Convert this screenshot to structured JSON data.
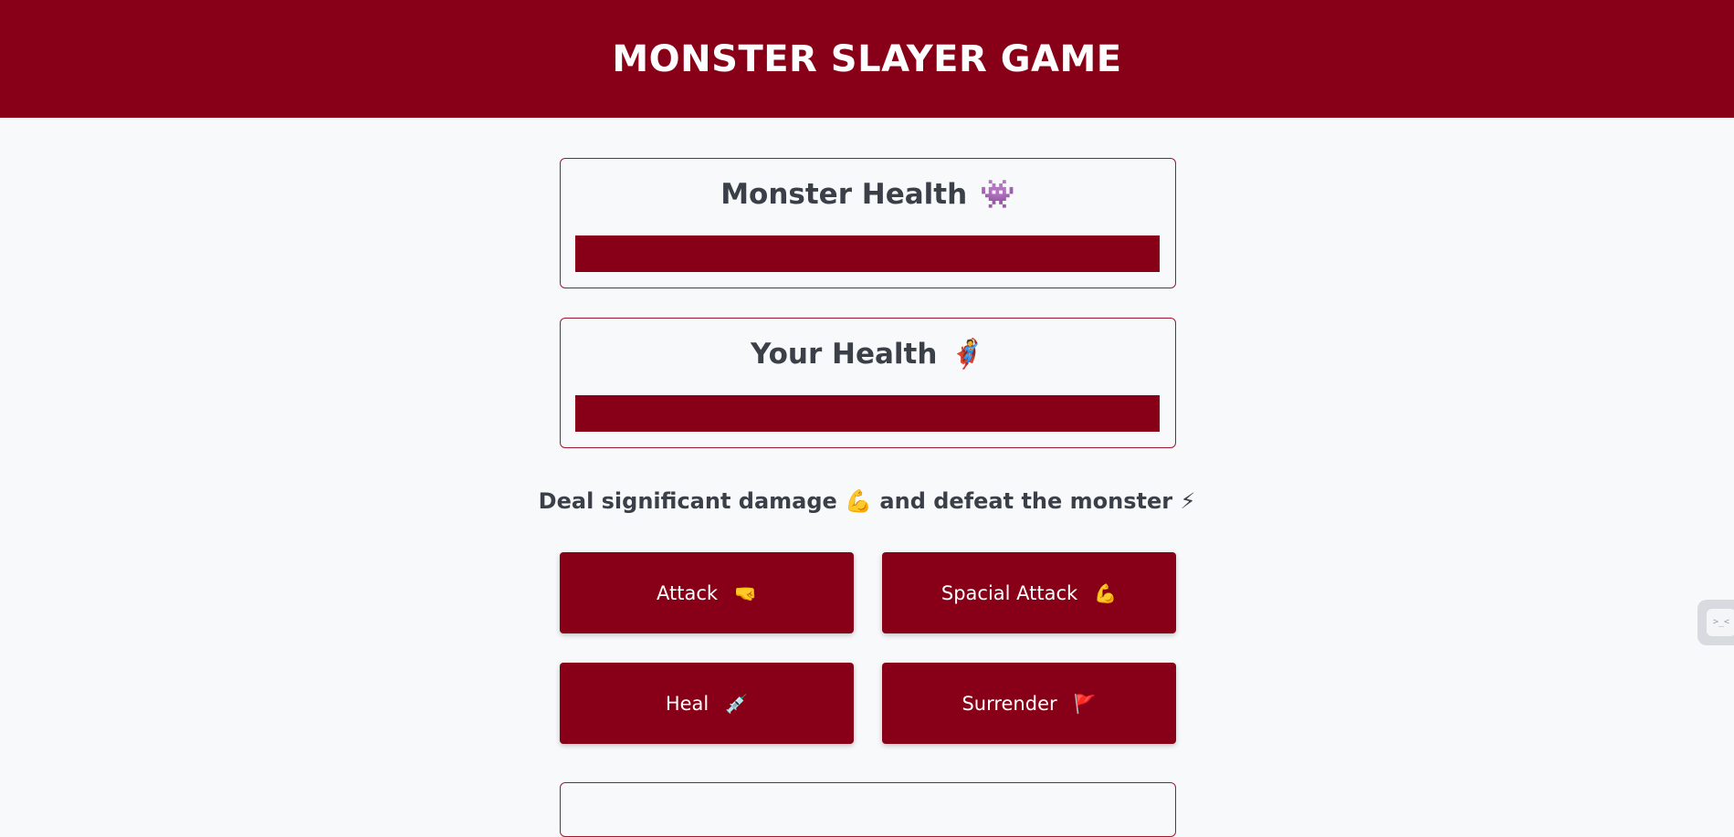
{
  "header": {
    "title": "MONSTER SLAYER GAME"
  },
  "monster_health": {
    "title": "Monster Health",
    "emoji": "👾",
    "level_percent": 100
  },
  "player_health": {
    "title": "Your Health",
    "emoji": "🦸",
    "level_percent": 100
  },
  "hint": {
    "text_before": "Deal significant damage",
    "emoji_1": "💪",
    "text_after": "and defeat the monster",
    "emoji_2": "⚡"
  },
  "controls": {
    "attack": {
      "label": "Attack",
      "emoji": "🤜"
    },
    "special_attack": {
      "label": "Spacial Attack",
      "emoji": "💪"
    },
    "heal": {
      "label": "Heal",
      "emoji": "💉"
    },
    "surrender": {
      "label": "Surrender",
      "emoji": "🚩"
    }
  },
  "side_widget": {
    "glyph": ">_<"
  },
  "colors": {
    "brand": "#880017",
    "background": "#f8f9fb",
    "text": "#3a3f48"
  }
}
